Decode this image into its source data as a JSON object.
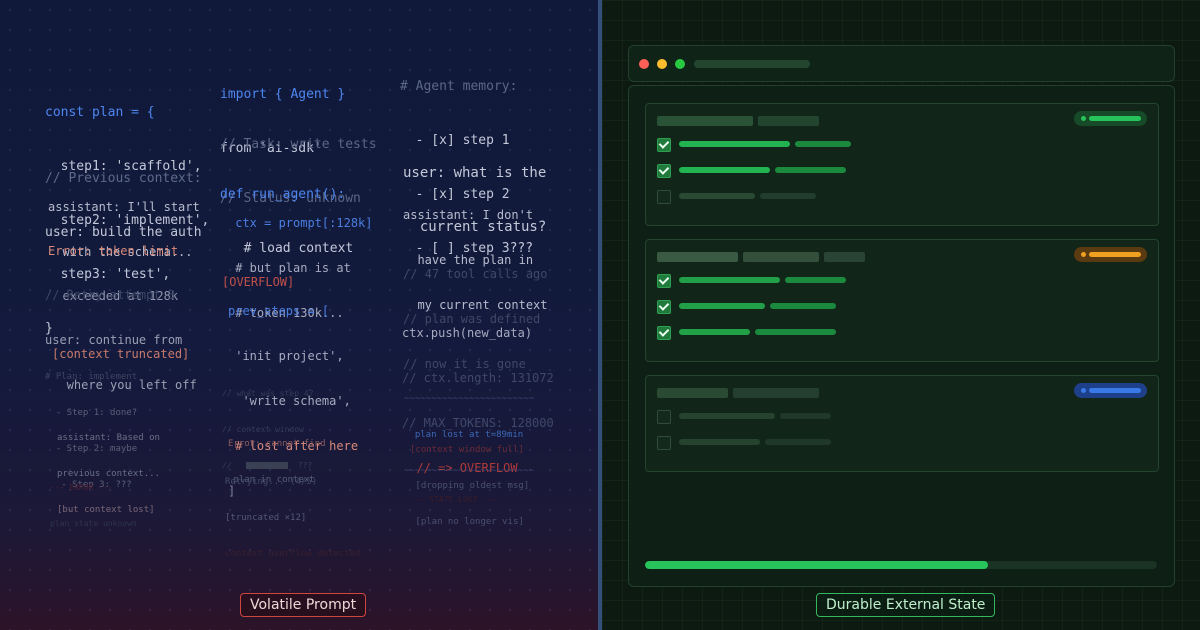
{
  "left_panel": {
    "col1": {
      "block1": [
        "const plan = {",
        "  step1: 'scaffold',",
        "  step2: 'implement',",
        "  step3: 'test',",
        "}"
      ],
      "block2": [
        "// Previous context:",
        "user: build the auth",
        "assistant: I'll start",
        "  with the schema..."
      ],
      "block3": [
        "Error: token limit",
        "  exceeded at 128k"
      ],
      "block4": [
        "// Retry attempt 3",
        "user: continue from",
        "   where you left off"
      ],
      "block5": [
        "[context truncated]"
      ],
      "block6": [
        "# Plan: implement",
        "  - Step 1: done?",
        "  - Step 2: maybe",
        "   - Step 3: ???"
      ],
      "block7": [
        "assistant: Based on",
        "previous context...",
        "[but context lost]"
      ],
      "block8": [
        "--- ERROR ---",
        "plan state unknown"
      ]
    },
    "col2": {
      "block1": [
        "import { Agent }",
        "from 'ai-sdk'"
      ],
      "block2": [
        "// Task: write tests",
        "// Status: unknown"
      ],
      "block3": [
        "def run_agent():",
        "  # load context",
        " ctx = prompt[:128k]",
        " # but plan is at",
        " # token 130k..."
      ],
      "block4": [
        "[OVERFLOW]"
      ],
      "block5": [
        "prev_steps = [",
        " 'init project',",
        "  'write schema',",
        " # lost after here",
        "]"
      ],
      "block6": [
        "// what was step 4?",
        "// context window",
        "//",
        "???"
      ],
      "block7": [
        "Error: cannot find",
        " plan in context"
      ],
      "block8": [
        "Retrying... (4/5)",
        "[truncated ×12]",
        "context overflow detected"
      ]
    },
    "col3": {
      "block1": [
        "# Agent memory:",
        "  - [x] step 1",
        "  - [x] step 2",
        "  - [ ] step 3???"
      ],
      "block2": [
        "user: what is the",
        "  current status?"
      ],
      "block3": [
        "assistant: I don't",
        "  have the plan in",
        "  my current context"
      ],
      "block4": [
        "// 47 tool calls ago",
        "// plan was defined",
        "// now it is gone"
      ],
      "block5": [
        "ctx.push(new_data)",
        "// ctx.length: 131072",
        "// MAX_TOKENS: 128000",
        "  // => OVERFLOW"
      ],
      "block6": [
        "~~~~~~~~~~~~~~~~~~~~~~~~",
        "  plan lost at t=89min",
        "~~~~~~~~~~~~~~~~~~~~~~~~"
      ],
      "block7": [
        "[context window full]",
        " [dropping oldest msg]",
        " [plan no longer vis]"
      ],
      "block8": [
        "--- STATE LOST ---"
      ]
    }
  },
  "right_panel": {
    "colors": {
      "green": "#26c45a",
      "amber": "#f0a020",
      "blue": "#3a7ae8",
      "close": "#ff5f57",
      "minimize": "#febc2e",
      "maximize": "#28c840"
    },
    "cards": [
      {
        "status": "complete",
        "status_color": "#26c45a",
        "rows": [
          true,
          true,
          false
        ]
      },
      {
        "status": "in-progress",
        "status_color": "#f0a020",
        "rows": [
          true,
          true,
          true
        ]
      },
      {
        "status": "pending",
        "status_color": "#3a7ae8",
        "rows": [
          false,
          false
        ]
      }
    ],
    "progress": 0.67
  },
  "labels": {
    "volatile": "Volatile Prompt",
    "durable": "Durable External State"
  }
}
